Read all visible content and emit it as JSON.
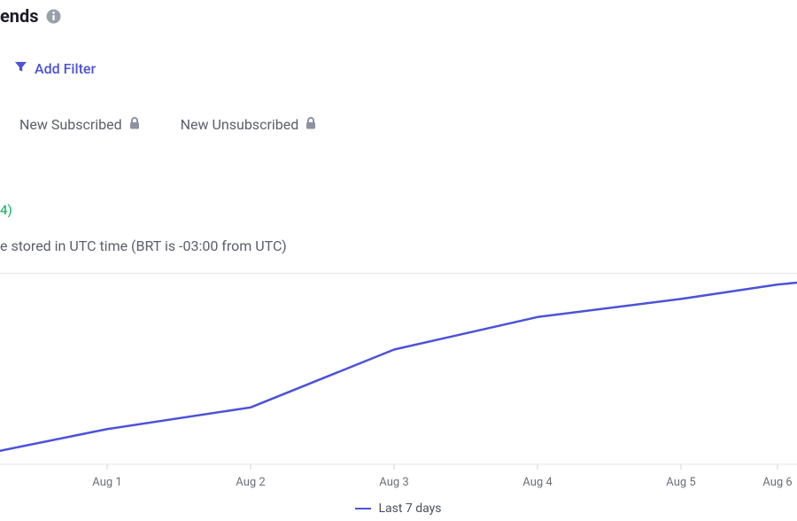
{
  "header": {
    "title_fragment": "ends"
  },
  "filter": {
    "add_label": "Add Filter"
  },
  "tabs": [
    {
      "label": "New Subscribed",
      "locked": true
    },
    {
      "label": "New Unsubscribed",
      "locked": true
    }
  ],
  "delta_fragment": "4)",
  "tz_note_fragment": "e stored in UTC time (BRT is -03:00 from UTC)",
  "legend": {
    "label": "Last 7 days"
  },
  "colors": {
    "accent": "#4c52d9",
    "positive": "#2eb872",
    "muted": "#5b5f6a",
    "grid": "#e3e6ea"
  },
  "chart_data": {
    "type": "line",
    "title": "",
    "xlabel": "",
    "ylabel": "",
    "categories": [
      "Aug 1",
      "Aug 2",
      "Aug 3",
      "Aug 4",
      "Aug 5",
      "Aug 6"
    ],
    "series": [
      {
        "name": "Last 7 days",
        "values": [
          18,
          30,
          62,
          80,
          90,
          98
        ]
      }
    ],
    "ylim": [
      0,
      100
    ],
    "grid": false,
    "legend_position": "bottom-center"
  }
}
